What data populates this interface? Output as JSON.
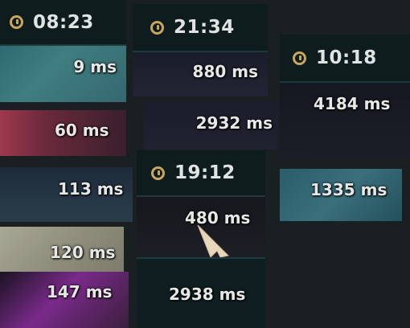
{
  "timers": [
    {
      "id": "t1",
      "time": "08:23"
    },
    {
      "id": "t2",
      "time": "21:34"
    },
    {
      "id": "t3",
      "time": "10:18"
    },
    {
      "id": "t4",
      "time": "19:12"
    }
  ],
  "latencies": [
    {
      "value": "9 ms"
    },
    {
      "value": "880 ms"
    },
    {
      "value": "4184 ms"
    },
    {
      "value": "60 ms"
    },
    {
      "value": "2932 ms"
    },
    {
      "value": "113 ms"
    },
    {
      "value": "1335 ms"
    },
    {
      "value": "480 ms"
    },
    {
      "value": "120 ms"
    },
    {
      "value": "147 ms"
    },
    {
      "value": "2938 ms"
    }
  ],
  "icons": {
    "timer": "clock-icon",
    "cursor": "mouse-cursor-icon"
  },
  "colors": {
    "accent_gold": "#c9a65e",
    "header_bg": "#0f1c1e"
  }
}
